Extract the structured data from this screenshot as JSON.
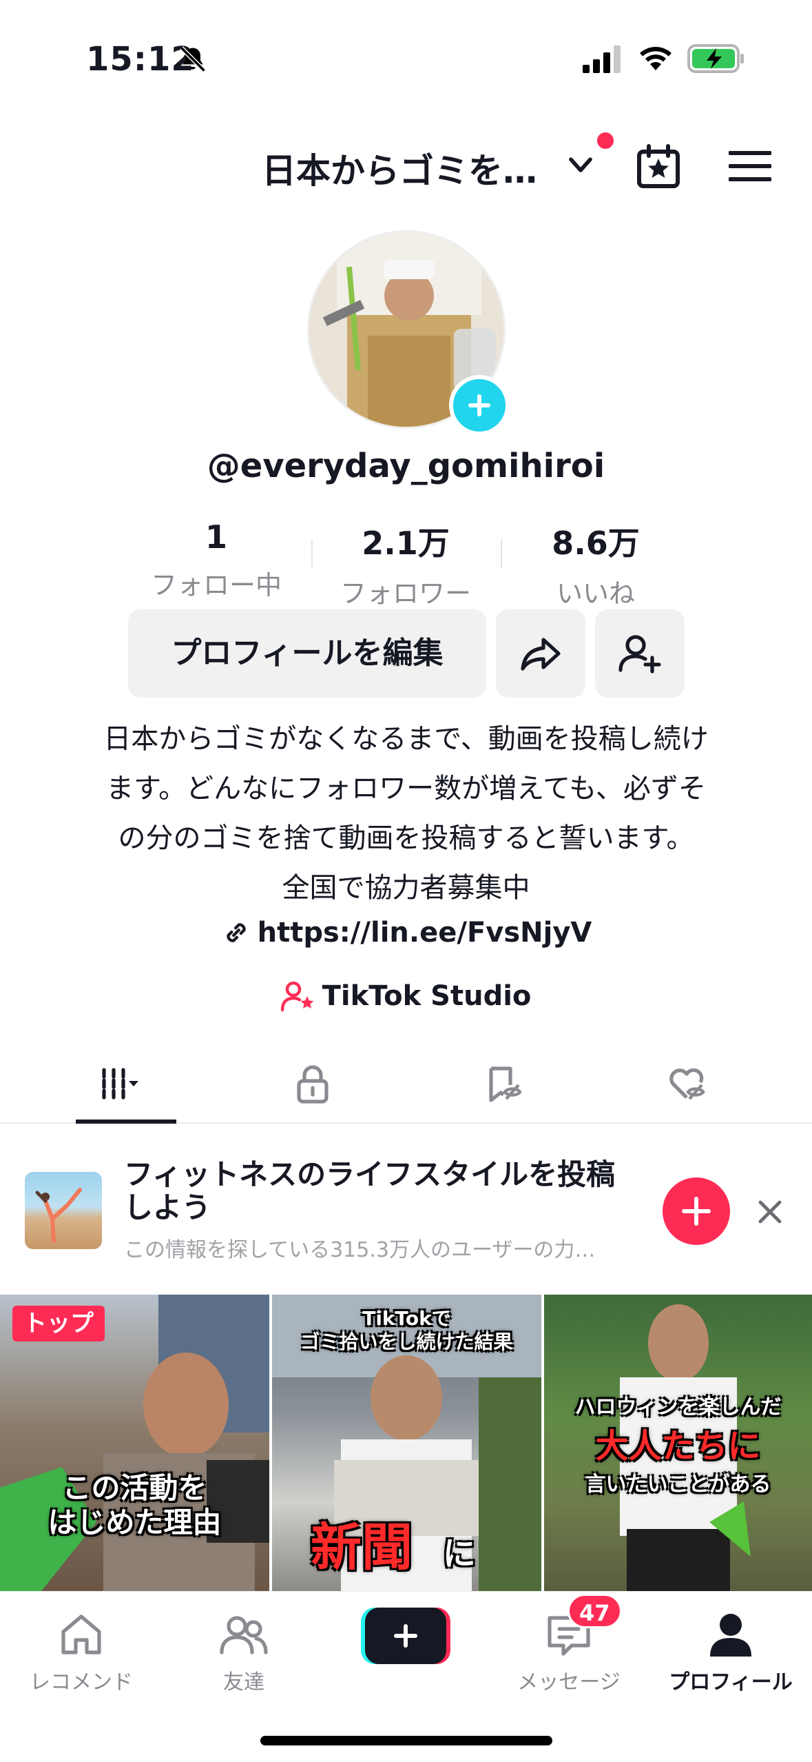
{
  "status_bar": {
    "time": "15:12"
  },
  "header": {
    "title": "日本からゴミを…"
  },
  "profile": {
    "username": "@everyday_gomihiroi",
    "stats": [
      {
        "value": "1",
        "label": "フォロー中"
      },
      {
        "value": "2.1万",
        "label": "フォロワー"
      },
      {
        "value": "8.6万",
        "label": "いいね"
      }
    ],
    "edit_button": "プロフィールを編集",
    "bio_lines": [
      "日本からゴミがなくなるまで、動画を投稿し続け",
      "ます。どんなにフォロワー数が増えても、必ずそ",
      "の分のゴミを捨て動画を投稿すると誓います。",
      "全国で協力者募集中"
    ],
    "link": "https://lin.ee/FvsNjyV",
    "studio": "TikTok Studio"
  },
  "suggestion": {
    "title": "フィットネスのライフスタイルを投稿しよう",
    "subtitle": "この情報を探している315.3万人のユーザーの力…"
  },
  "videos": [
    {
      "badge": "トップ",
      "caption_lines": [
        "この活動を",
        "はじめた理由"
      ]
    },
    {
      "caption_top": [
        "TikTokで",
        "ゴミ拾いをし続けた結果"
      ],
      "caption_big": "新聞",
      "caption_small": "に"
    },
    {
      "caption_lines": [
        "ハロウィンを楽しんだ",
        "大人たちに",
        "言いたいことがある"
      ]
    }
  ],
  "bottom_nav": {
    "items": [
      {
        "label": "レコメンド",
        "icon": "home-icon"
      },
      {
        "label": "友達",
        "icon": "friends-icon"
      },
      {
        "label": "メッセージ",
        "icon": "inbox-icon"
      },
      {
        "label": "プロフィール",
        "icon": "profile-icon"
      }
    ],
    "message_badge": "47"
  },
  "colors": {
    "accent": "#fe2c55",
    "avatar_add": "#20d5ec"
  }
}
